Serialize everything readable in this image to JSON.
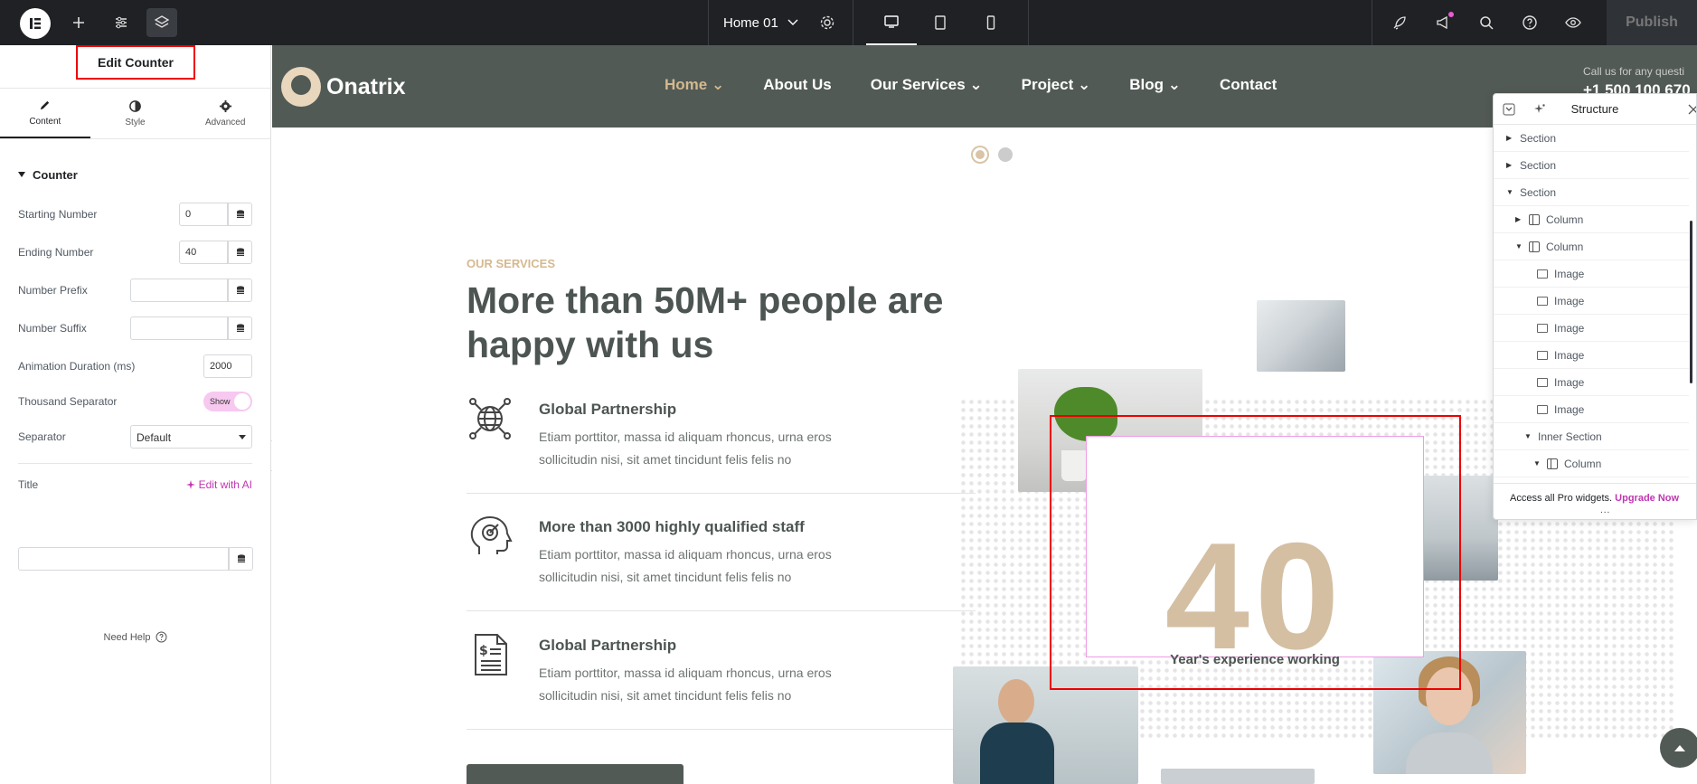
{
  "topbar": {
    "page_name": "Home 01",
    "publish_label": "Publish"
  },
  "panel": {
    "title": "Edit Counter",
    "tabs": [
      {
        "label": "Content",
        "icon": "pencil-icon"
      },
      {
        "label": "Style",
        "icon": "half-circle-icon"
      },
      {
        "label": "Advanced",
        "icon": "gear-icon"
      }
    ],
    "section_title": "Counter",
    "controls": {
      "starting_number": {
        "label": "Starting Number",
        "value": "0"
      },
      "ending_number": {
        "label": "Ending Number",
        "value": "40"
      },
      "number_prefix": {
        "label": "Number Prefix",
        "value": ""
      },
      "number_suffix": {
        "label": "Number Suffix",
        "value": ""
      },
      "animation_duration": {
        "label": "Animation Duration (ms)",
        "value": "2000"
      },
      "thousand_separator": {
        "label": "Thousand Separator",
        "toggle_text": "Show"
      },
      "separator": {
        "label": "Separator",
        "value": "Default"
      },
      "title": {
        "label": "Title",
        "ai_label": "Edit with AI",
        "value": ""
      }
    },
    "need_help": "Need Help"
  },
  "site": {
    "logo_text": "Onatrix",
    "nav": [
      "Home",
      "About Us",
      "Our Services",
      "Project",
      "Blog",
      "Contact"
    ],
    "call_text": "Call us for any questi",
    "call_number": "+1 500 100 670",
    "eyebrow": "OUR SERVICES",
    "heading_line1": "More than 50M+ people are",
    "heading_line2": "happy with us",
    "features": [
      {
        "title": "Global Partnership",
        "desc_line1": "Etiam porttitor, massa id aliquam rhoncus, urna eros",
        "desc_line2": "sollicitudin nisi, sit amet tincidunt felis felis no"
      },
      {
        "title": "More than 3000 highly qualified staff",
        "desc_line1": "Etiam porttitor, massa id aliquam rhoncus, urna eros",
        "desc_line2": "sollicitudin nisi, sit amet tincidunt felis felis no"
      },
      {
        "title": "Global Partnership",
        "desc_line1": "Etiam porttitor, massa id aliquam rhoncus, urna eros",
        "desc_line2": "sollicitudin nisi, sit amet tincidunt felis felis no"
      }
    ],
    "counter": {
      "number": "40",
      "title": "Year's experience working"
    }
  },
  "structure": {
    "title": "Structure",
    "items": [
      {
        "label": "Section",
        "arrow": "▶",
        "kind": "none"
      },
      {
        "label": "Section",
        "arrow": "▶",
        "kind": "none"
      },
      {
        "label": "Section",
        "arrow": "▼",
        "kind": "none"
      },
      {
        "label": "Column",
        "arrow": "▶",
        "kind": "column"
      },
      {
        "label": "Column",
        "arrow": "▼",
        "kind": "column"
      },
      {
        "label": "Image",
        "arrow": "",
        "kind": "image"
      },
      {
        "label": "Image",
        "arrow": "",
        "kind": "image"
      },
      {
        "label": "Image",
        "arrow": "",
        "kind": "image"
      },
      {
        "label": "Image",
        "arrow": "",
        "kind": "image"
      },
      {
        "label": "Image",
        "arrow": "",
        "kind": "image"
      },
      {
        "label": "Image",
        "arrow": "",
        "kind": "image"
      },
      {
        "label": "Inner Section",
        "arrow": "▼",
        "kind": "none"
      },
      {
        "label": "Column",
        "arrow": "▼",
        "kind": "column"
      }
    ],
    "footer_text": "Access all Pro widgets.",
    "footer_link": "Upgrade Now",
    "more": "..."
  },
  "colors": {
    "topbar_bg": "#1f2124",
    "site_header_bg": "#525a55",
    "accent_gold": "#d4b98f",
    "ai_pink": "#c036b1",
    "selection_red": "#e00000"
  }
}
